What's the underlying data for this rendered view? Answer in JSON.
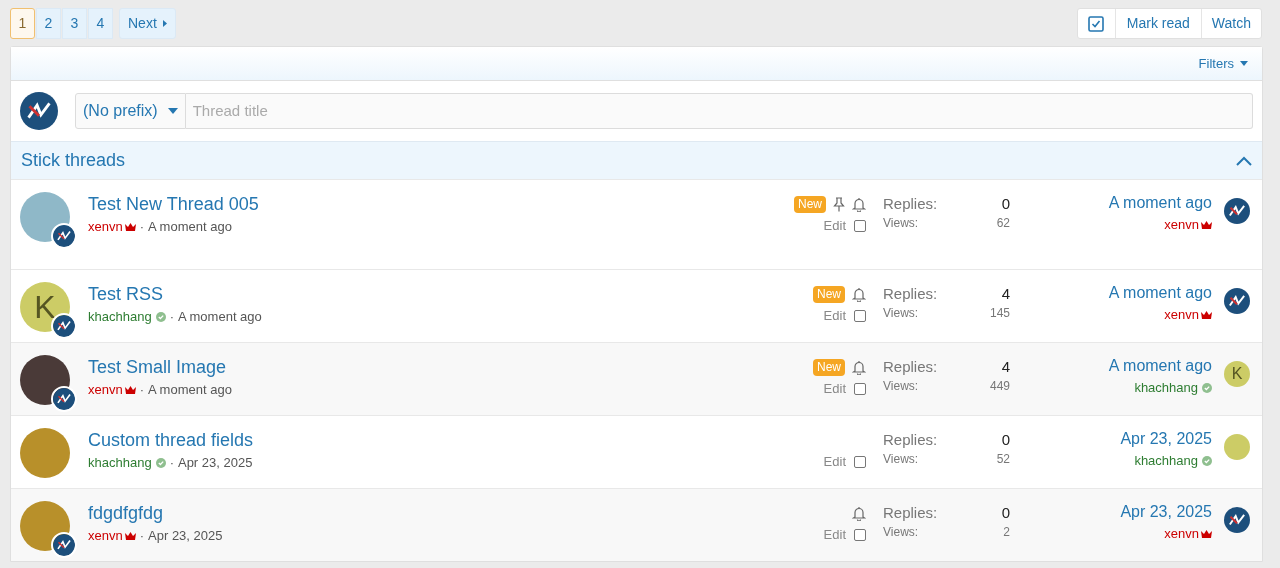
{
  "pagination": {
    "pages": [
      {
        "label": "1",
        "selected": true
      },
      {
        "label": "2",
        "selected": false
      },
      {
        "label": "3",
        "selected": false
      },
      {
        "label": "4",
        "selected": false
      }
    ],
    "next": "Next"
  },
  "actions": {
    "mark_read": "Mark read",
    "watch": "Watch"
  },
  "filters": "Filters",
  "quick_thread": {
    "prefix": "(No prefix)",
    "placeholder": "Thread title"
  },
  "sections": [
    {
      "title": "Stick threads",
      "expanded": true,
      "threads": [
        {
          "title": "Test New Thread 005",
          "author": {
            "name": "xenvn",
            "kind": "admin"
          },
          "separator": "·",
          "date": "A moment ago",
          "avatar": {
            "kind": "photo",
            "color": "#8fb8c8"
          },
          "badge": true,
          "new_label": "New",
          "pinned": true,
          "watched": true,
          "edit": "Edit",
          "checked": false,
          "replies_label": "Replies:",
          "replies": "0",
          "views_label": "Views:",
          "views": "62",
          "last_date": "A moment ago",
          "last_user": {
            "name": "xenvn",
            "kind": "admin"
          },
          "last_avatar": {
            "kind": "logo"
          }
        }
      ]
    },
    {
      "threads": [
        {
          "title": "Test RSS",
          "author": {
            "name": "khachhang",
            "kind": "member"
          },
          "separator": "·",
          "date": "A moment ago",
          "avatar": {
            "kind": "letter",
            "color": "#cccc66",
            "letter": "K"
          },
          "badge": true,
          "new_label": "New",
          "pinned": false,
          "watched": true,
          "edit": "Edit",
          "checked": false,
          "replies_label": "Replies:",
          "replies": "4",
          "views_label": "Views:",
          "views": "145",
          "last_date": "A moment ago",
          "last_user": {
            "name": "xenvn",
            "kind": "admin"
          },
          "last_avatar": {
            "kind": "logo"
          }
        },
        {
          "title": "Test Small Image",
          "author": {
            "name": "xenvn",
            "kind": "admin"
          },
          "separator": "·",
          "date": "A moment ago",
          "avatar": {
            "kind": "photo",
            "color": "#4a3a38"
          },
          "badge": true,
          "new_label": "New",
          "pinned": false,
          "watched": true,
          "edit": "Edit",
          "checked": false,
          "replies_label": "Replies:",
          "replies": "4",
          "views_label": "Views:",
          "views": "449",
          "last_date": "A moment ago",
          "last_user": {
            "name": "khachhang",
            "kind": "member"
          },
          "last_avatar": {
            "kind": "letter",
            "letter": "K"
          }
        },
        {
          "title": "Custom thread fields",
          "author": {
            "name": "khachhang",
            "kind": "member"
          },
          "separator": "·",
          "date": "Apr 23, 2025",
          "avatar": {
            "kind": "photo",
            "color": "#b8902a"
          },
          "badge": false,
          "pinned": false,
          "watched": false,
          "edit": "Edit",
          "checked": false,
          "replies_label": "Replies:",
          "replies": "0",
          "views_label": "Views:",
          "views": "52",
          "last_date": "Apr 23, 2025",
          "last_user": {
            "name": "khachhang",
            "kind": "member"
          },
          "last_avatar": {
            "kind": "letter"
          }
        },
        {
          "title": "fdgdfgfdg",
          "author": {
            "name": "xenvn",
            "kind": "admin"
          },
          "separator": "·",
          "date": "Apr 23, 2025",
          "avatar": {
            "kind": "photo",
            "color": "#b8902a"
          },
          "badge": true,
          "pinned": false,
          "watched": true,
          "edit": "Edit",
          "checked": false,
          "replies_label": "Replies:",
          "replies": "0",
          "views_label": "Views:",
          "views": "2",
          "last_date": "Apr 23, 2025",
          "last_user": {
            "name": "xenvn",
            "kind": "admin"
          },
          "last_avatar": {
            "kind": "logo"
          }
        }
      ]
    }
  ]
}
